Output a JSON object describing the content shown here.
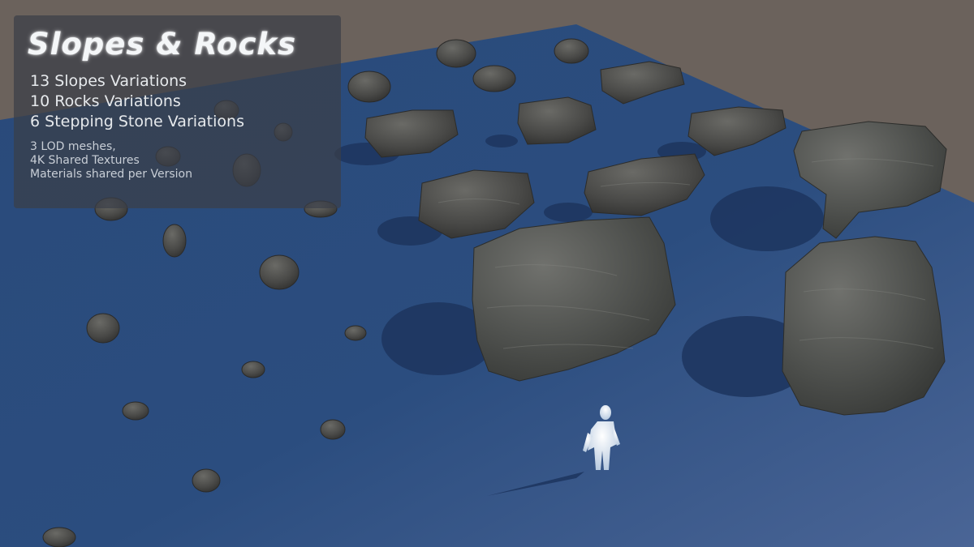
{
  "panel": {
    "title": "Slopes & Rocks",
    "features": [
      "13 Slopes Variations",
      "10 Rocks Variations",
      "6 Stepping Stone Variations"
    ],
    "details": [
      "3 LOD meshes,",
      "4K Shared Textures",
      "Materials shared per Version"
    ]
  },
  "colors": {
    "background": "#6b625c",
    "ground": "#2b4d7e",
    "rock": "#4a4a48",
    "figure": "#dbe6f2"
  },
  "scene_objects": {
    "ground_plane": "blue-ground-plane",
    "rocks": "rock-meshes",
    "scale_figure": "human-scale-reference"
  }
}
